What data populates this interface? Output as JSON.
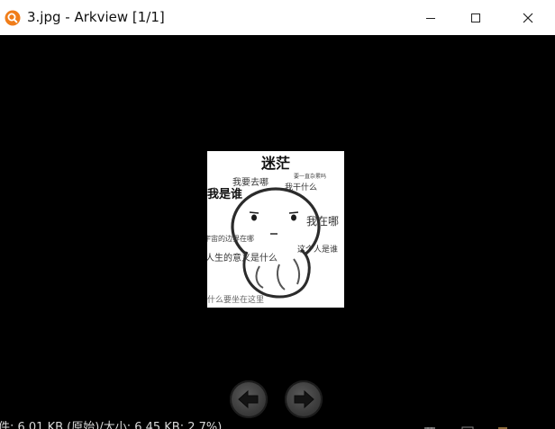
{
  "window": {
    "title": "3.jpg - Arkview [1/1]",
    "icon": "magnifier-app-icon",
    "controls": [
      "minimize-icon",
      "maximize-icon",
      "close-icon"
    ]
  },
  "image": {
    "texts": {
      "confused": "迷茫",
      "where_going": "我要去哪",
      "what_doing_1": "要一直杂累吗",
      "what_doing_2": "我干什么",
      "who_am_i": "我是谁",
      "where_am_i": "我在哪",
      "universe_edge": "宇宙的边界在哪",
      "who_is_this": "这个人是谁",
      "meaning_of_life": "人生的意义是什么",
      "why_here": "什么要坐在这里"
    }
  },
  "navigation": {
    "prev_icon": "arrow-left-icon",
    "next_icon": "arrow-right-icon"
  },
  "statusbar": {
    "text": "件: 6.01 KB (原始)/大小: 6.45 KB: 2.7%)"
  },
  "colors": {
    "background": "#000000",
    "titlebar": "#ffffff",
    "app_icon": "#f07d1a"
  }
}
